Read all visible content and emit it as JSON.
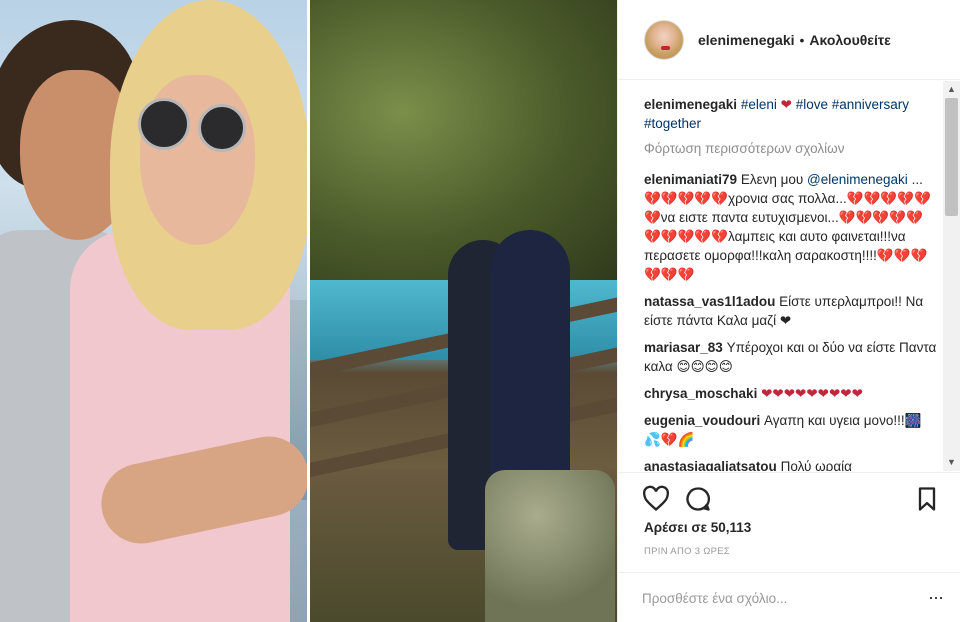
{
  "header": {
    "username": "elenimenegaki",
    "separator": "•",
    "follow_status": "Ακολουθείτε"
  },
  "caption": {
    "username": "elenimenegaki",
    "tags": [
      "#eleni",
      "#love",
      "#anniversary",
      "#together"
    ],
    "heart": "❤"
  },
  "load_more": "Φόρτωση περισσότερων σχολίων",
  "comments": [
    {
      "username": "elenimaniati79",
      "text_before": "Ελενη μου",
      "mention": "@elenimenegaki",
      "text_after": "...💔💔💔💔💔χρονια σας πολλα...💔💔💔💔💔💔να ειστε παντα ευτυχισμενοι...💔💔💔💔💔💔💔💔💔💔λαμπεις και αυτο φαινεται!!!να περασετε ομορφα!!!καλη σαρακοστη!!!!💔💔💔💔💔💔"
    },
    {
      "username": "natassa_vas1l1adou",
      "text": "Είστε υπερλαμπροι!! Να είστε πάντα Καλα μαζί ❤"
    },
    {
      "username": "mariasar_83",
      "text": "Υπέροχοι και οι δύο να είστε Παντα καλα 😊😊😊😊"
    },
    {
      "username": "chrysa_moschaki",
      "text": "❤❤❤❤❤❤❤❤❤"
    },
    {
      "username": "eugenia_voudouri",
      "text": "Αγαπη και υγεια μονο!!!🎆💦💔🌈"
    },
    {
      "username": "anastasiagaliatsatou",
      "text": "Πολύ ωραία"
    }
  ],
  "icons": {
    "like": "heart-outline-icon",
    "comment": "speech-bubble-icon",
    "bookmark": "bookmark-icon",
    "more": "ellipsis-icon"
  },
  "likes_text": "Αρέσει σε 50,113",
  "time_text": "ΠΡΙΝ ΑΠΟ 3 ΩΡΕΣ",
  "add_comment": {
    "placeholder": "Προσθέστε ένα σχόλιο...",
    "value": ""
  },
  "more_label": "···",
  "scrollbar": {
    "up": "▲",
    "down": "▼"
  },
  "colors": {
    "link": "#003569",
    "heart": "#c2263a",
    "muted": "#8e8e8e",
    "border": "#efefef"
  }
}
